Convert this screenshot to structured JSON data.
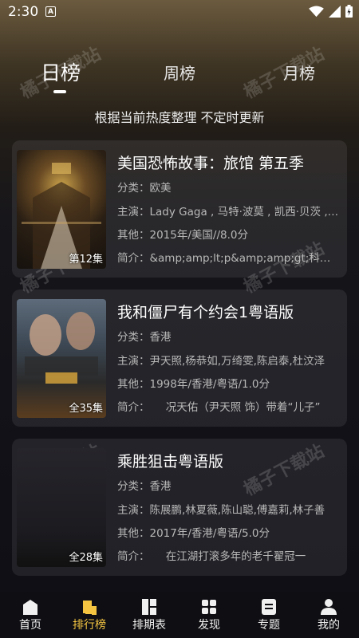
{
  "status_bar": {
    "time": "2:30",
    "notification_icon": "A"
  },
  "tabs": [
    {
      "label": "日榜",
      "active": true
    },
    {
      "label": "周榜",
      "active": false
    },
    {
      "label": "月榜",
      "active": false
    }
  ],
  "subtitle": "根据当前热度整理 不定时更新",
  "watermark": "橘子下载站",
  "cards": [
    {
      "title": "美国恐怖故事：旅馆 第五季",
      "badge": "第12集",
      "category": "分类：欧美",
      "cast": "主演：Lady Gaga , 马特·波莫 , 凯西·贝茨 , 萨拉·保罗森",
      "other": "其他：2015年/美国//8.0分",
      "intro": "简介：&amp;amp;lt;p&amp;amp;gt;科特妮·考克斯"
    },
    {
      "title": "我和僵尸有个约会1粤语版",
      "badge": "全35集",
      "category": "分类：香港",
      "cast": "主演：尹天照,杨恭如,万绮雯,陈启泰,杜汶泽",
      "other": "其他：1998年/香港/粤语/1.0分",
      "intro": "简介：　　况天佑（尹天照 饰）带着“儿子”"
    },
    {
      "title": "乘胜狙击粤语版",
      "badge": "全28集",
      "category": "分类：香港",
      "cast": "主演：陈展鹏,林夏薇,陈山聪,傅嘉莉,林子善",
      "other": "其他：2017年/香港/粤语/5.0分",
      "intro": "简介：　　在江湖打滚多年的老千翟冠一"
    }
  ],
  "bottom_nav": [
    {
      "label": "首页",
      "icon": "home-icon",
      "active": false
    },
    {
      "label": "排行榜",
      "icon": "ranking-icon",
      "active": true
    },
    {
      "label": "排期表",
      "icon": "schedule-icon",
      "active": false
    },
    {
      "label": "发现",
      "icon": "discover-icon",
      "active": false
    },
    {
      "label": "专题",
      "icon": "topic-icon",
      "active": false
    },
    {
      "label": "我的",
      "icon": "profile-icon",
      "active": false
    }
  ],
  "colors": {
    "accent": "#f5c542",
    "card_bg": "#26252b",
    "background": "#121218"
  }
}
